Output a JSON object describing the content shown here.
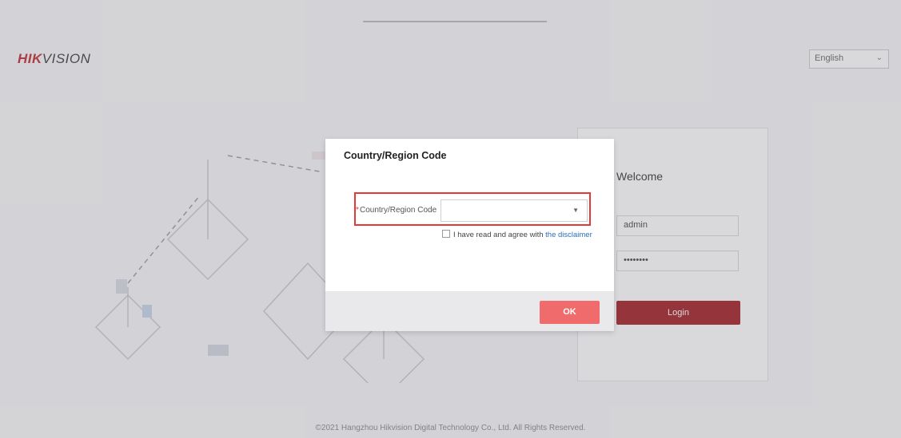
{
  "header": {
    "logo_hik": "HIK",
    "logo_vision": "VISION",
    "language": "English"
  },
  "login": {
    "welcome": "Welcome",
    "username": "admin",
    "password": "••••••••",
    "login_label": "Login"
  },
  "footer": {
    "copyright": "©2021 Hangzhou Hikvision Digital Technology Co., Ltd. All Rights Reserved."
  },
  "dialog": {
    "title": "Country/Region Code",
    "field_label": "Country/Region Code",
    "required_mark": "*",
    "select_value": "",
    "agree_text": "I have read and agree with ",
    "disclaimer_link": "the disclaimer",
    "ok_label": "OK"
  },
  "colors": {
    "brand_red": "#c0272d",
    "login_button": "#a31b20",
    "ok_button": "#f06b6b",
    "highlight_border": "#e53935",
    "link": "#2a6fb8"
  }
}
